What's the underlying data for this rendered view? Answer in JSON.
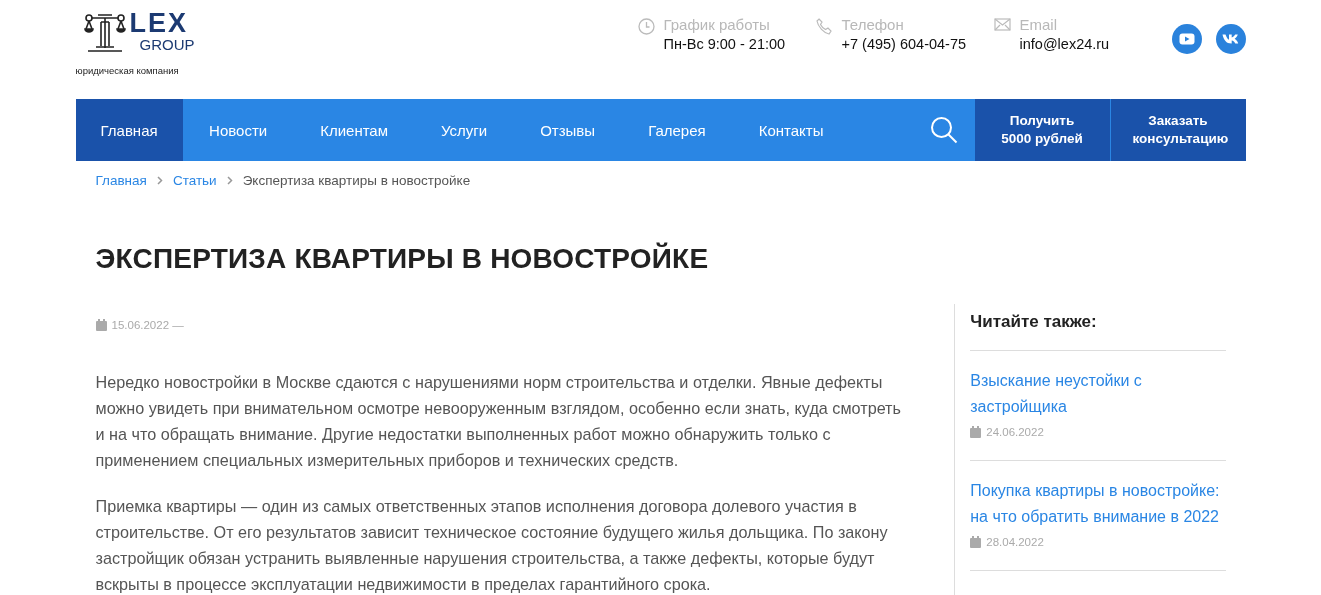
{
  "logo": {
    "word": "LEX",
    "sub": "GROUP",
    "tagline": "юридическая компания"
  },
  "contacts": [
    {
      "kind": "clock",
      "label": "График работы",
      "value": "Пн-Вс 9:00 - 21:00"
    },
    {
      "kind": "phone",
      "label": "Телефон",
      "value": "+7 (495) 604-04-75"
    },
    {
      "kind": "mail",
      "label": "Email",
      "value": "info@lex24.ru"
    }
  ],
  "social": [
    {
      "kind": "youtube"
    },
    {
      "kind": "vk"
    }
  ],
  "nav": [
    {
      "label": "Главная",
      "selected": true
    },
    {
      "label": "Новости",
      "selected": false
    },
    {
      "label": "Клиентам",
      "selected": false
    },
    {
      "label": "Услуги",
      "selected": false
    },
    {
      "label": "Отзывы",
      "selected": false
    },
    {
      "label": "Галерея",
      "selected": false
    },
    {
      "label": "Контакты",
      "selected": false
    }
  ],
  "nav_buttons": [
    "Получить 5000 рублей",
    "Заказать консультацию"
  ],
  "breadcrumbs": [
    {
      "label": "Главная",
      "link": true
    },
    {
      "label": "Статьи",
      "link": true
    },
    {
      "label": "Экспертиза квартиры в новостройке",
      "link": false
    }
  ],
  "title": "ЭКСПЕРТИЗА КВАРТИРЫ В НОВОСТРОЙКЕ",
  "date": "15.06.2022 —",
  "paragraphs": [
    "Нередко новостройки в Москве сдаются с нарушениями норм строительства и отделки. Явные дефекты можно увидеть при внимательном осмотре невооруженным взглядом, особенно если знать, куда смотреть и на что обращать внимание. Другие недостатки выполненных работ можно обнаружить только с применением специальных измерительных приборов и технических средств.",
    "Приемка квартиры — один из самых ответственных этапов исполнения договора долевого участия в строительстве. От его результатов зависит техническое состояние будущего жилья дольщика. По закону застройщик обязан устранить выявленные нарушения строительства, а также дефекты, которые будут вскрыты в процессе эксплуатации недвижимости в пределах гарантийного срока."
  ],
  "sidebar": {
    "heading": "Читайте также:",
    "items": [
      {
        "title": "Взыскание неустойки с застройщика",
        "date": "24.06.2022"
      },
      {
        "title": "Покупка квартиры в новостройке: на что обратить внимание в 2022",
        "date": "28.04.2022"
      }
    ]
  }
}
